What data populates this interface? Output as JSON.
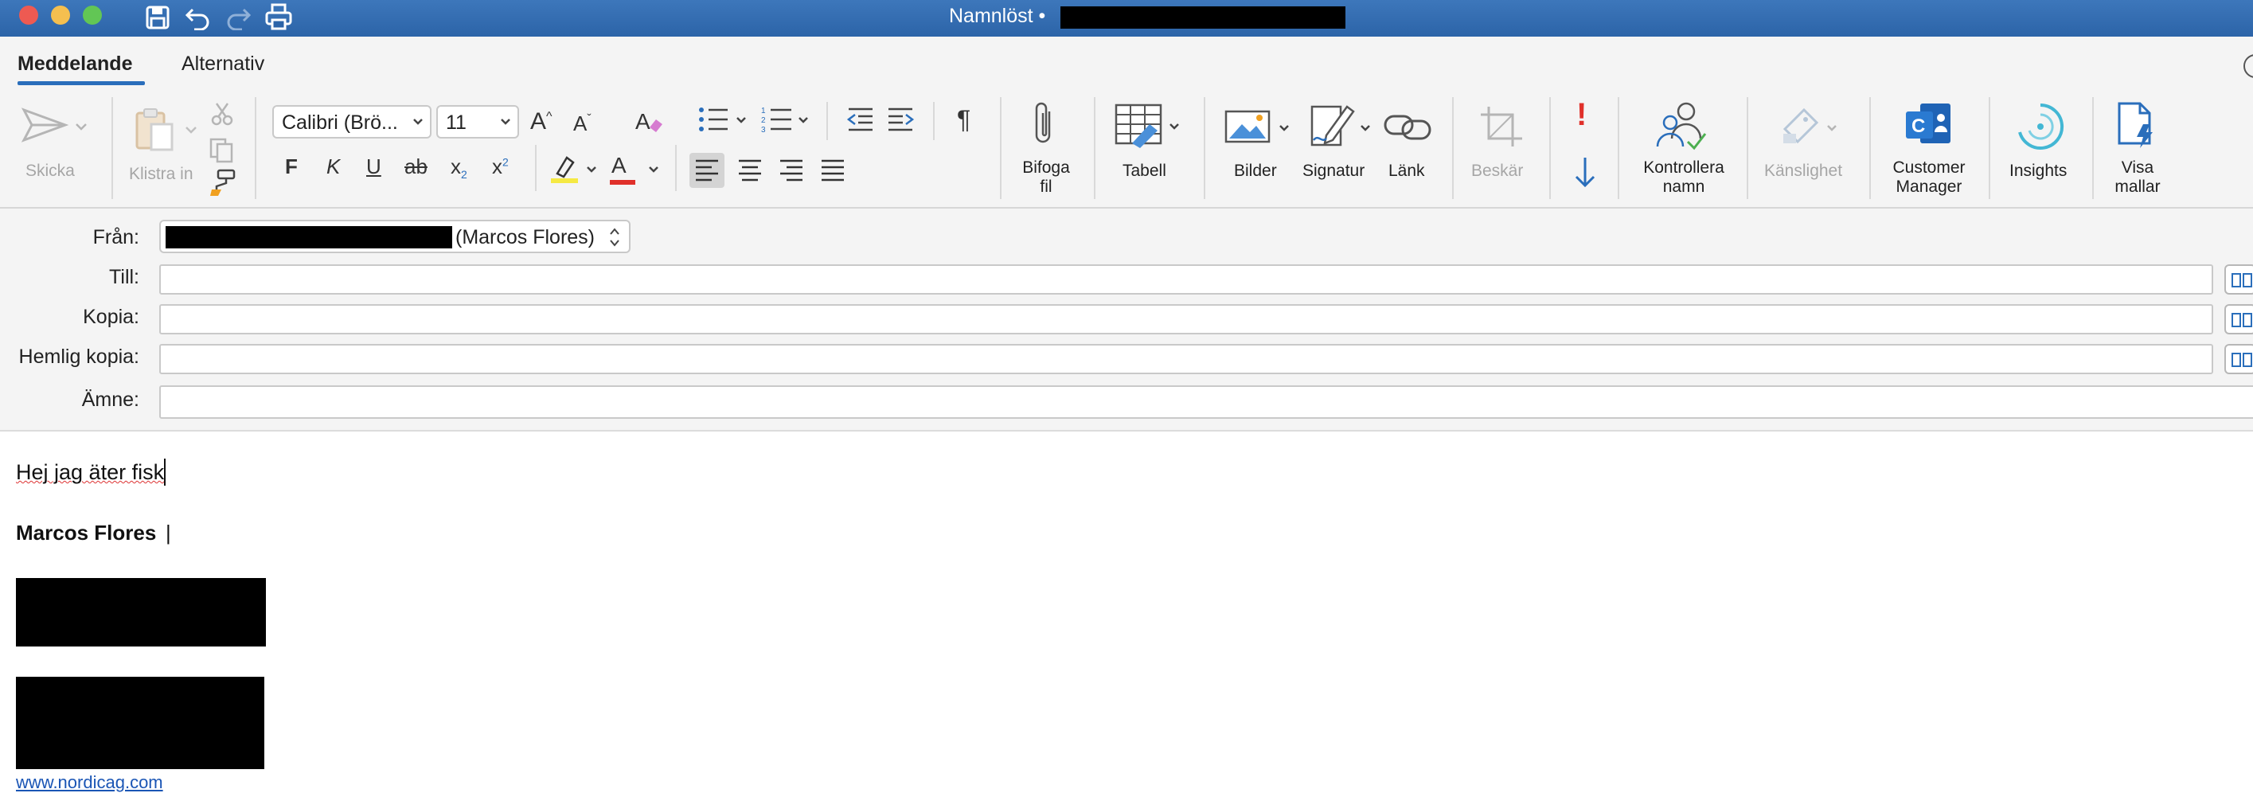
{
  "window": {
    "title": "Namnlöst •",
    "traffic_lights": {
      "close": "#ee5a52",
      "minimize": "#f5bf4f",
      "zoom": "#62c655"
    },
    "quick_icons": [
      "save-icon",
      "undo-icon",
      "redo-icon",
      "print-icon"
    ]
  },
  "tabs": [
    "Meddelande",
    "Alternativ"
  ],
  "ribbon": {
    "send": "Skicka",
    "paste": "Klistra in",
    "font_name": "Calibri (Brö...",
    "font_size": "11",
    "bold": "F",
    "italic": "K",
    "underline": "U",
    "strike": "ab",
    "subscript": "x",
    "superscript": "x",
    "subscript_small": "2",
    "superscript_small": "2",
    "font_color_glyph": "A",
    "attach": [
      "Bifoga",
      "fil"
    ],
    "table": "Tabell",
    "pictures": "Bilder",
    "signature": "Signatur",
    "link": "Länk",
    "crop": "Beskär",
    "check_names": [
      "Kontrollera",
      "namn"
    ],
    "sensitivity": "Känslighet",
    "customer_manager": [
      "Customer",
      "Manager"
    ],
    "insights": "Insights",
    "view_templates": [
      "Visa",
      "mallar"
    ],
    "colors": {
      "highlight": "#f5e943",
      "font_color": "#e0302a",
      "accent": "#2a6ebb",
      "importance": "#e0302a"
    }
  },
  "fields": {
    "from_label": "Från:",
    "from_value": "(Marcos Flores)",
    "to_label": "Till:",
    "cc_label": "Kopia:",
    "bcc_label": "Hemlig kopia:",
    "subject_label": "Ämne:",
    "to_value": "",
    "cc_value": "",
    "bcc_value": "",
    "subject_value": ""
  },
  "body": {
    "line1": "Hej jag äter fisk",
    "signature_name": "Marcos Flores",
    "signature_sep": "|",
    "link": "www.nordicag.com"
  }
}
